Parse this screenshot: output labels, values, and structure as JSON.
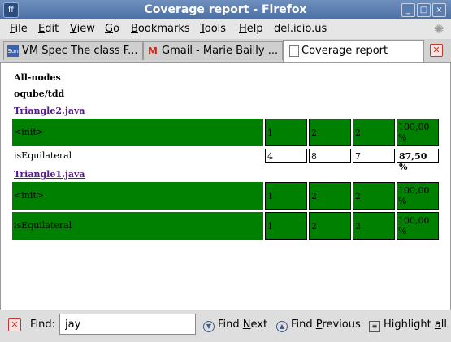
{
  "window": {
    "title": "Coverage report - Firefox",
    "app_icon": "firefox-icon",
    "controls": {
      "minimize": "_",
      "maximize": "□",
      "close": "×"
    }
  },
  "menu": {
    "items": [
      {
        "label": "File",
        "accel": "F",
        "rest": "ile"
      },
      {
        "label": "Edit",
        "accel": "E",
        "rest": "dit"
      },
      {
        "label": "View",
        "accel": "V",
        "rest": "iew"
      },
      {
        "label": "Go",
        "accel": "G",
        "rest": "o"
      },
      {
        "label": "Bookmarks",
        "accel": "B",
        "rest": "ookmarks"
      },
      {
        "label": "Tools",
        "accel": "T",
        "rest": "ools"
      },
      {
        "label": "Help",
        "accel": "H",
        "rest": "elp"
      }
    ],
    "extra": "del.icio.us"
  },
  "tabs": [
    {
      "label": "VM Spec The class F...",
      "icon": "sun-icon",
      "icon_text": "Sun",
      "active": false
    },
    {
      "label": "Gmail - Marie Bailly ...",
      "icon": "gmail-icon",
      "icon_text": "M",
      "active": false
    },
    {
      "label": "Coverage report",
      "icon": "page-icon",
      "icon_text": "",
      "active": true
    }
  ],
  "report": {
    "heading1": "All-nodes",
    "heading2": "oqube/tdd",
    "classes": [
      {
        "name": "Triangle2.java",
        "methods": [
          {
            "name": "<init>",
            "c1": "1",
            "c2": "2",
            "c3": "2",
            "pct": "100,00 %",
            "status": "full",
            "color": "#008000"
          },
          {
            "name": "isEquilateral",
            "c1": "4",
            "c2": "8",
            "c3": "7",
            "pct": "87,50 %",
            "status": "partial",
            "color": "#ffffff"
          }
        ]
      },
      {
        "name": "Triangle1.java",
        "methods": [
          {
            "name": "<init>",
            "c1": "1",
            "c2": "2",
            "c3": "2",
            "pct": "100,00 %",
            "status": "full",
            "color": "#008000"
          },
          {
            "name": "isEquilateral",
            "c1": "1",
            "c2": "2",
            "c3": "2",
            "pct": "100,00 %",
            "status": "full",
            "color": "#008000"
          }
        ]
      }
    ]
  },
  "findbar": {
    "label": "Find:",
    "value": "jay",
    "next_accel": "N",
    "next_pre": "Find ",
    "next_rest": "ext",
    "prev_accel": "P",
    "prev_pre": "Find ",
    "prev_rest": "revious",
    "highlight_accel": "a",
    "highlight_pre": "Highlight ",
    "highlight_rest": "ll"
  }
}
